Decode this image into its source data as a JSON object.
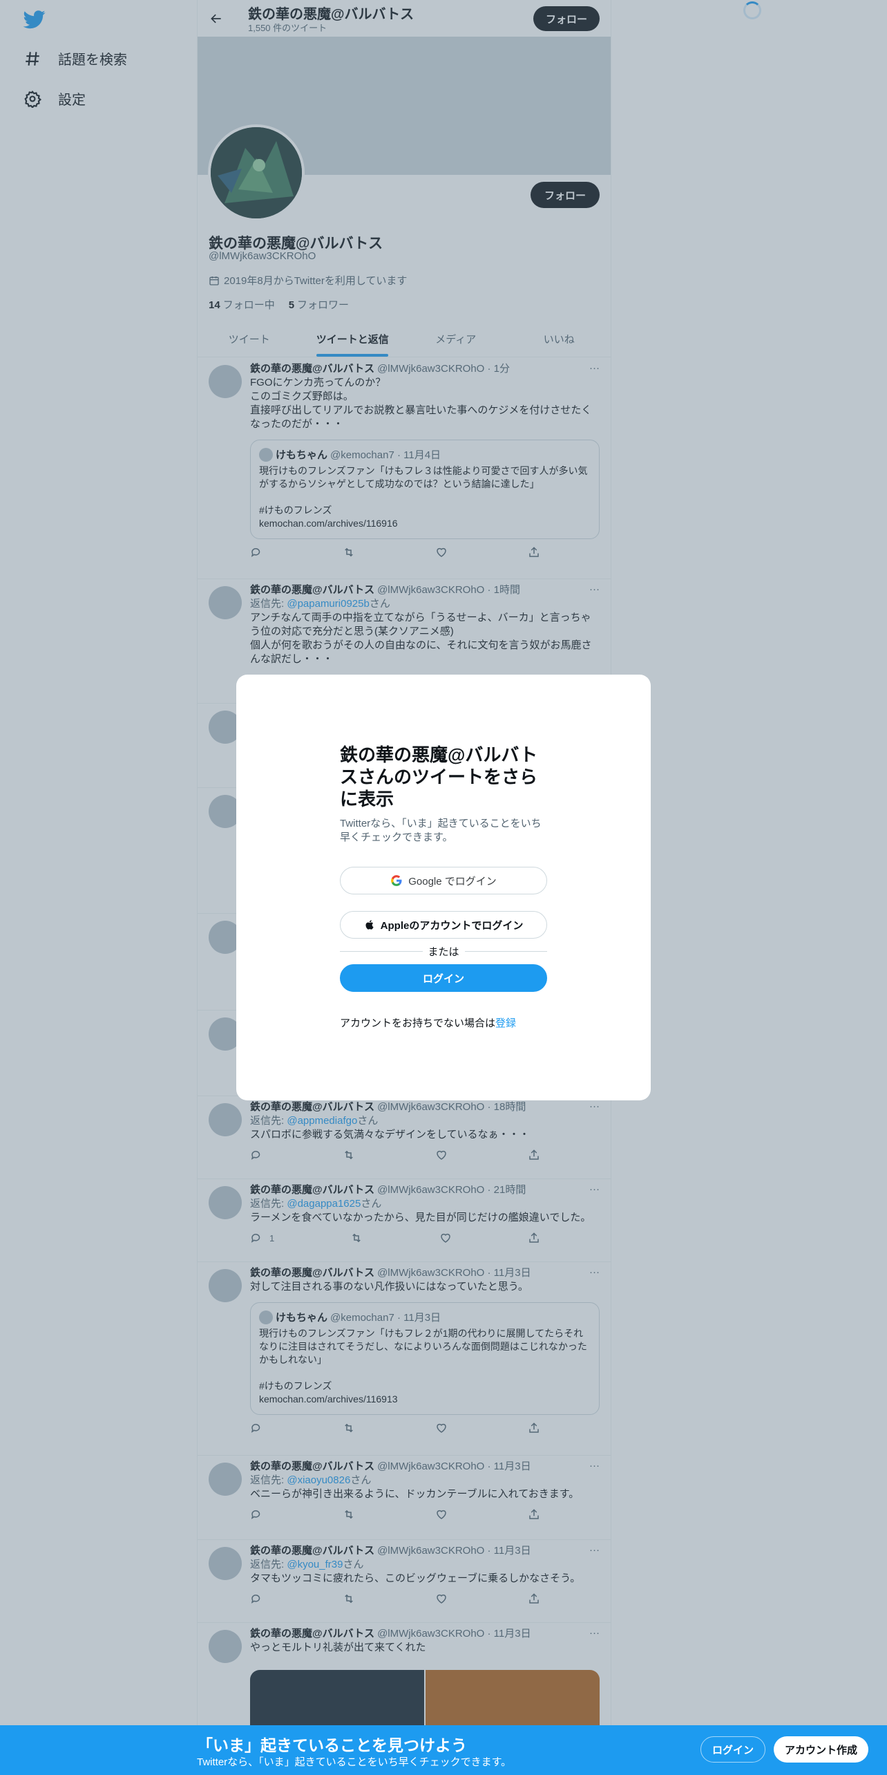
{
  "colors": {
    "brand": "#1d9bf0",
    "text": "#0f1419",
    "secondary": "#536471",
    "overlay": "#5b7083"
  },
  "nav": {
    "logo_icon": "twitter-bird-icon",
    "explore_label": "話題を検索",
    "settings_label": "設定"
  },
  "header": {
    "name": "鉄の華の悪魔@バルバトス",
    "tweet_count": "1,550 件のツイート",
    "follow_label": "フォロー"
  },
  "profile": {
    "name": "鉄の華の悪魔@バルバトス",
    "handle": "@lMWjk6aw3CKROhO",
    "joined": "2019年8月からTwitterを利用しています",
    "following_count": "14",
    "following_label": "フォロー中",
    "followers_count": "5",
    "followers_label": "フォロワー",
    "follow_label": "フォロー"
  },
  "tabs": [
    "ツイート",
    "ツイートと返信",
    "メディア",
    "いいね"
  ],
  "tweets": [
    {
      "name": "鉄の華の悪魔@バルバトス",
      "meta": "@lMWjk6aw3CKROhO · 1分",
      "text": "FGOにケンカ売ってんのか？\nこのゴミクズ野郎は。\n直接呼び出してリアルでお説教と暴言吐いた事へのケジメを付けさせたくなったのだが・・・",
      "quote": {
        "name": "けもちゃん",
        "meta": "@kemochan7 · 11月4日",
        "text": "現行けものフレンズファン「けもフレ３は性能より可愛さで回す人が多い気がするからソシャゲとして成功なのでは？という結論に達した」\n\n#けものフレンズ\nkemochan.com/archives/116916"
      }
    },
    {
      "name": "鉄の華の悪魔@バルバトス",
      "meta": "@lMWjk6aw3CKROhO · 1時間",
      "reply_prefix": "返信先: ",
      "reply_to": "@papamuri0925b",
      "reply_suffix": "さん",
      "text": "アンチなんて両手の中指を立てながら「うるせーよ、バーカ」と言っちゃう位の対応で充分だと思う(某クソアニメ感)\n個人が何を歌おうがその人の自由なのに、それに文句を言う奴がお馬鹿さんな訳だし・・・"
    },
    {
      "name": "鉄の華の悪魔@バルバトス",
      "meta": "@lMWjk6aw3CKROhO · 18時間",
      "reply_prefix": "返信先: ",
      "reply_to": "@appmediafgo",
      "reply_suffix": "さん",
      "text": "スパロボに参戦する気満々なデザインをしているなぁ・・・"
    },
    {
      "name": "鉄の華の悪魔@バルバトス",
      "meta": "@lMWjk6aw3CKROhO · 21時間",
      "reply_prefix": "返信先: ",
      "reply_to": "@dagappa1625",
      "reply_suffix": "さん",
      "text": "ラーメンを食べていなかったから、見た目が同じだけの艦娘違いでした。",
      "reply_count": "1"
    },
    {
      "name": "鉄の華の悪魔@バルバトス",
      "meta": "@lMWjk6aw3CKROhO · 11月3日",
      "text": "対して注目される事のない凡作扱いにはなっていたと思う。",
      "quote": {
        "name": "けもちゃん",
        "meta": "@kemochan7 · 11月3日",
        "text": "現行けものフレンズファン「けもフレ２が1期の代わりに展開してたらそれなりに注目はされてそうだし、なによりいろんな面倒問題はこじれなかったかもしれない」\n\n#けものフレンズ\nkemochan.com/archives/116913"
      }
    },
    {
      "name": "鉄の華の悪魔@バルバトス",
      "meta": "@lMWjk6aw3CKROhO · 11月3日",
      "reply_prefix": "返信先: ",
      "reply_to": "@xiaoyu0826",
      "reply_suffix": "さん",
      "text": "ベニーらが神引き出来るように、ドッカンテーブルに入れておきます。"
    },
    {
      "name": "鉄の華の悪魔@バルバトス",
      "meta": "@lMWjk6aw3CKROhO · 11月3日",
      "reply_prefix": "返信先: ",
      "reply_to": "@kyou_fr39",
      "reply_suffix": "さん",
      "text": "タマもツッコミに疲れたら、このビッグウェーブに乗るしかなさそう。"
    },
    {
      "name": "鉄の華の悪魔@バルバトス",
      "meta": "@lMWjk6aw3CKROhO · 11月3日",
      "text": "やっとモルトリ礼装が出て来てくれた"
    }
  ],
  "modal": {
    "title": "鉄の華の悪魔@バルバトスさんのツイートをさらに表示",
    "subtitle": "Twitterなら、「いま」起きていることをいち早くチェックできます。",
    "google_label": "Google でログイン",
    "apple_label": "Appleのアカウントでログイン",
    "or_label": "または",
    "login_label": "ログイン",
    "signup_prefix": "アカウントをお持ちでない場合は",
    "signup_link": "登録"
  },
  "bottom_bar": {
    "title": "「いま」起きていることを見つけよう",
    "subtitle": "Twitterなら、「いま」起きていることをいち早くチェックできます。",
    "login_label": "ログイン",
    "signup_label": "アカウント作成"
  }
}
